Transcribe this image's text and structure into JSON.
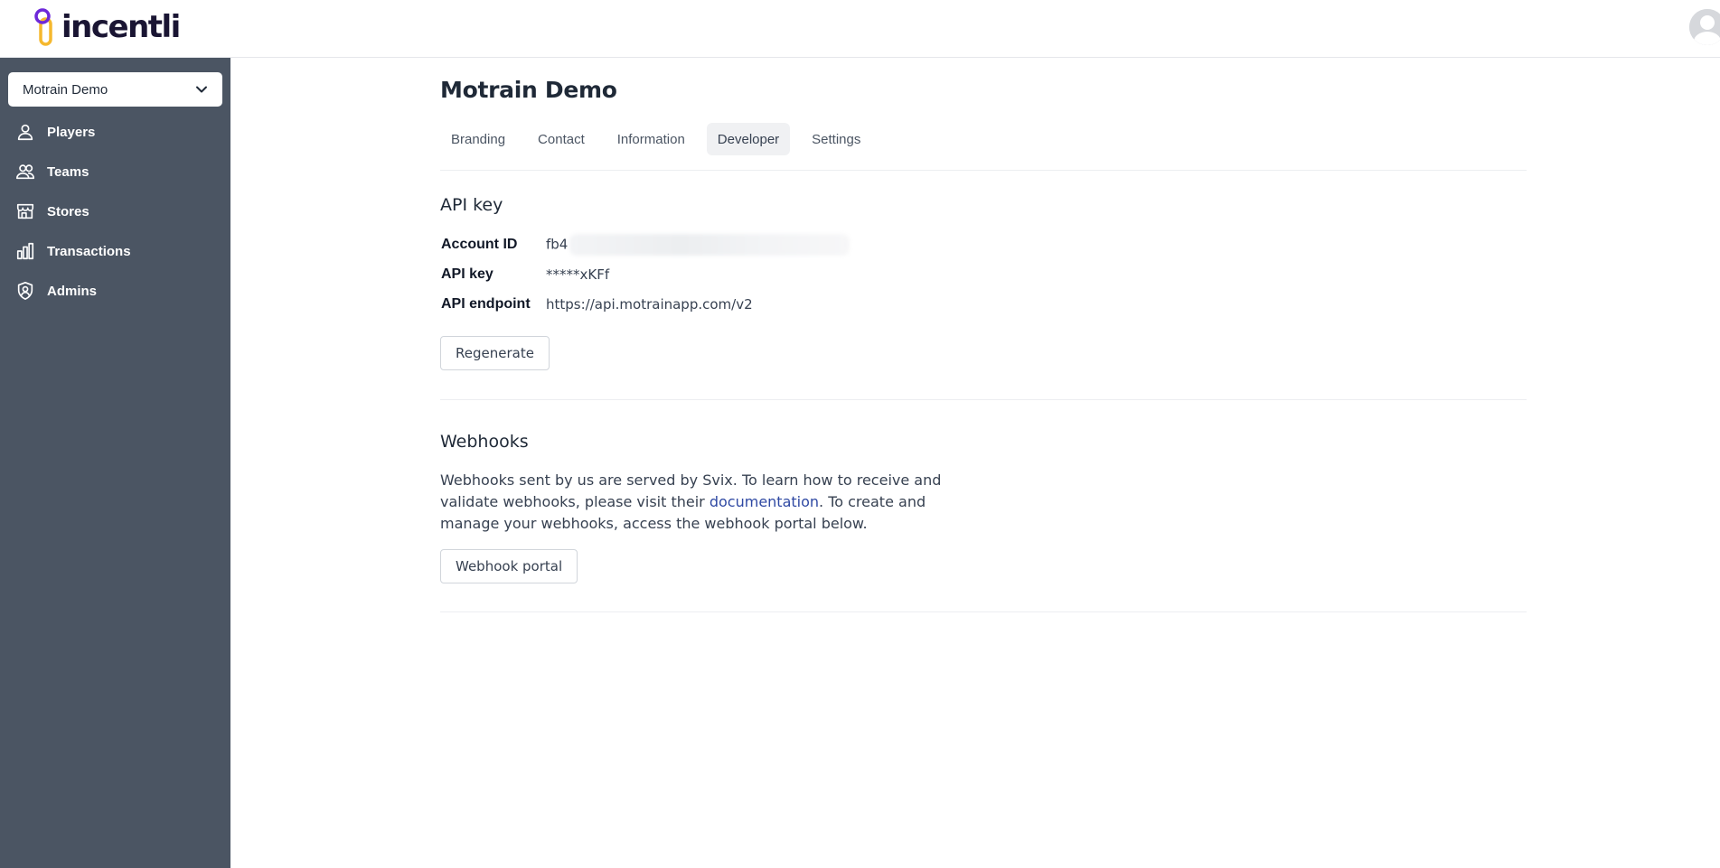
{
  "brand": {
    "name": "incentli"
  },
  "sidebar": {
    "org_select": "Motrain Demo",
    "items": [
      {
        "label": "Players",
        "icon": "user-icon"
      },
      {
        "label": "Teams",
        "icon": "users-icon"
      },
      {
        "label": "Stores",
        "icon": "store-icon"
      },
      {
        "label": "Transactions",
        "icon": "bar-chart-icon"
      },
      {
        "label": "Admins",
        "icon": "shield-user-icon"
      }
    ]
  },
  "page": {
    "title": "Motrain Demo",
    "tabs": [
      {
        "label": "Branding",
        "active": false
      },
      {
        "label": "Contact",
        "active": false
      },
      {
        "label": "Information",
        "active": false
      },
      {
        "label": "Developer",
        "active": true
      },
      {
        "label": "Settings",
        "active": false
      }
    ]
  },
  "api_key_section": {
    "title": "API key",
    "rows": [
      {
        "key": "Account ID",
        "value": "fb4"
      },
      {
        "key": "API key",
        "value": "*****xKFf"
      },
      {
        "key": "API endpoint",
        "value": "https://api.motrainapp.com/v2"
      }
    ],
    "regenerate_label": "Regenerate"
  },
  "webhooks_section": {
    "title": "Webhooks",
    "text_before_link": "Webhooks sent by us are served by Svix. To learn how to receive and validate webhooks, please visit their ",
    "link_text": "documentation",
    "text_after_link": ". To create and manage your webhooks, access the webhook portal below.",
    "portal_button_label": "Webhook portal"
  },
  "colors": {
    "sidebar_bg": "#4b5563",
    "link": "#2f49a3",
    "brand_purple": "#6d28d9",
    "brand_yellow": "#f5b82e"
  }
}
